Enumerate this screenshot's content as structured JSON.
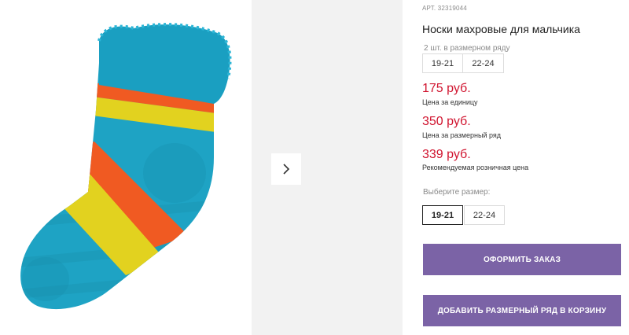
{
  "gallery": {
    "main_image_alt": "",
    "next_icon": "chevron-right-icon"
  },
  "product": {
    "article": "АРТ. 32319044",
    "title": "Носки махровые для мальчика",
    "pack_label": "2 шт. в размерном ряду",
    "pack_sizes": [
      "19-21",
      "22-24"
    ]
  },
  "prices": {
    "unit_price": "175 руб.",
    "unit_note": "Цена за единицу",
    "pack_price": "350 руб.",
    "pack_note": "Цена за размерный ряд",
    "retail_price": "339 руб.",
    "retail_note": "Рекомендуемая розничная цена"
  },
  "size_select": {
    "label": "Выберите размер:",
    "options": [
      "19-21",
      "22-24"
    ],
    "selected": "19-21"
  },
  "buttons": {
    "order": "ОФОРМИТЬ ЗАКАЗ",
    "add_to_cart": "ДОБАВИТЬ РАЗМЕРНЫЙ РЯД В КОРЗИНУ"
  },
  "colors": {
    "price": "#d0132e",
    "button": "#7b63a6",
    "sock_blue": "#1ea3c4",
    "stripe_orange": "#f05a22",
    "stripe_yellow": "#e2d21f"
  }
}
